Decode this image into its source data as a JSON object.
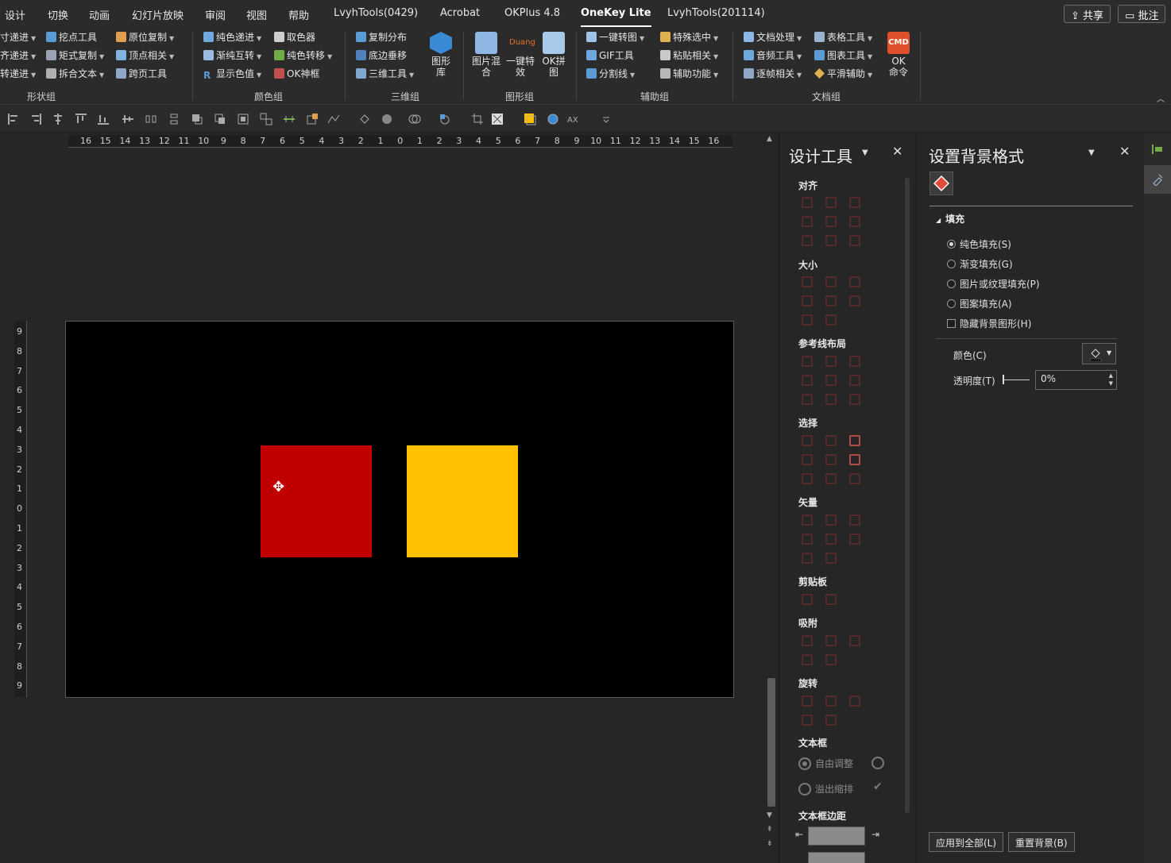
{
  "tabs": [
    "设计",
    "切换",
    "动画",
    "幻灯片放映",
    "审阅",
    "视图",
    "帮助",
    "LvyhTools(0429)",
    "Acrobat",
    "OKPlus 4.8",
    "OneKey Lite",
    "LvyhTools(201114)"
  ],
  "active_tab": "OneKey Lite",
  "top_buttons": {
    "share": "共享",
    "comments": "批注"
  },
  "ribbon": {
    "groups": {
      "shape": "形状组",
      "color": "颜色组",
      "three_d": "三维组",
      "graphic": "图形组",
      "assist": "辅助组",
      "document": "文档组"
    },
    "shape_items": [
      "寸递进",
      "挖点工具",
      "原位复制",
      "齐递进",
      "矩式复制",
      "顶点相关",
      "转递进",
      "拆合文本",
      "跨页工具"
    ],
    "color_items": [
      "纯色递进",
      "取色器",
      "渐纯互转",
      "纯色转移",
      "显示色值",
      "OK神框"
    ],
    "three_d_items": [
      "复制分布",
      "底边垂移",
      "三维工具",
      "图形库"
    ],
    "graphic_items": [
      "图片混合",
      "一键特效",
      "OK拼图"
    ],
    "assist_items": [
      "一键转图",
      "特殊选中",
      "GIF工具",
      "粘贴相关",
      "分割线",
      "辅助功能"
    ],
    "doc_items": [
      "文档处理",
      "表格工具",
      "音频工具",
      "图表工具",
      "逐帧相关",
      "平滑辅助",
      "OK命令"
    ],
    "cmd_badge": "CMD"
  },
  "ruler": {
    "horizontal": [
      "16",
      "15",
      "14",
      "13",
      "12",
      "11",
      "10",
      "9",
      "8",
      "7",
      "6",
      "5",
      "4",
      "3",
      "2",
      "1",
      "0",
      "1",
      "2",
      "3",
      "4",
      "5",
      "6",
      "7",
      "8",
      "9",
      "10",
      "11",
      "12",
      "13",
      "14",
      "15",
      "16"
    ],
    "vertical": [
      "9",
      "8",
      "7",
      "6",
      "5",
      "4",
      "3",
      "2",
      "1",
      "0",
      "1",
      "2",
      "3",
      "4",
      "5",
      "6",
      "7",
      "8",
      "9"
    ]
  },
  "slide": {
    "background": "#000000",
    "shapes": [
      {
        "name": "red-square",
        "color": "#c00000"
      },
      {
        "name": "yellow-square",
        "color": "#ffc000"
      }
    ]
  },
  "design_pane": {
    "title": "设计工具",
    "sections": [
      "对齐",
      "大小",
      "参考线布局",
      "选择",
      "矢量",
      "剪贴板",
      "吸附",
      "旋转",
      "文本框",
      "文本框边距"
    ],
    "textbox_opts": [
      "自由调整",
      "溢出缩排"
    ]
  },
  "format_pane": {
    "title": "设置背景格式",
    "fill_section": "填充",
    "fill_options": [
      "纯色填充(S)",
      "渐变填充(G)",
      "图片或纹理填充(P)",
      "图案填充(A)"
    ],
    "selected_fill": "纯色填充(S)",
    "hide_graphics": "隐藏背景图形(H)",
    "color_label": "颜色(C)",
    "transparency_label": "透明度(T)",
    "transparency_value": "0%",
    "apply_all": "应用到全部(L)",
    "reset": "重置背景(B)"
  },
  "colors": {
    "accent": "#c0504d",
    "cmd": "#e0502a"
  }
}
